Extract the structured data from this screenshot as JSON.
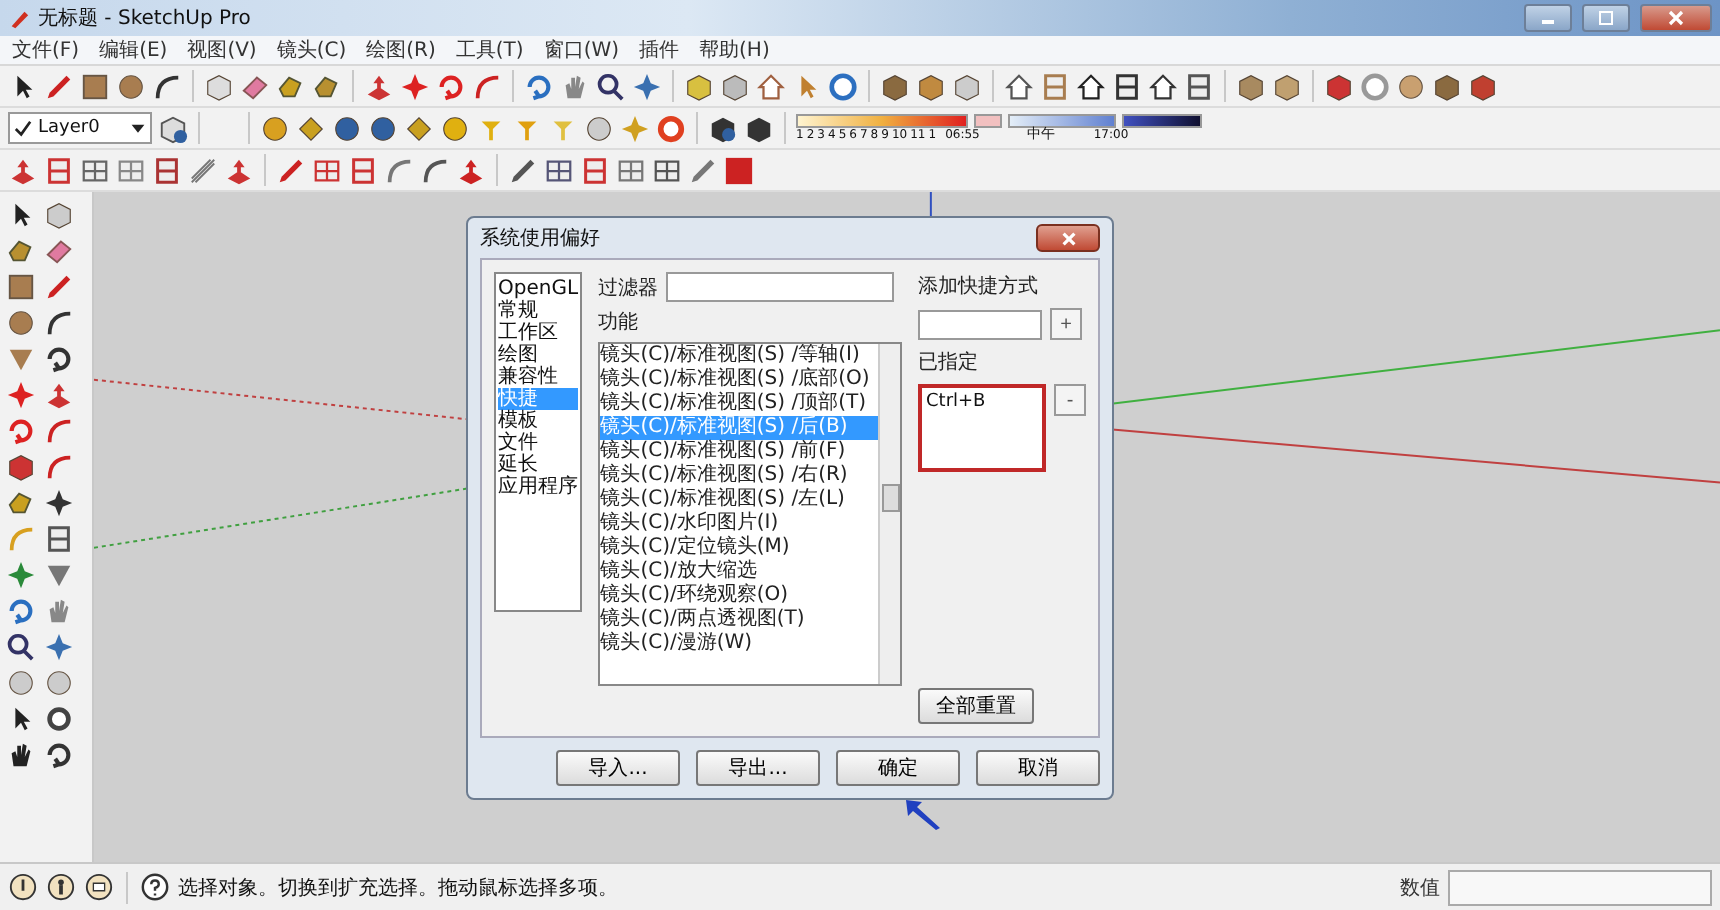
{
  "window": {
    "title": "无标题 - SketchUp Pro"
  },
  "menu": [
    "文件(F)",
    "编辑(E)",
    "视图(V)",
    "镜头(C)",
    "绘图(R)",
    "工具(T)",
    "窗口(W)",
    "插件",
    "帮助(H)"
  ],
  "layer": {
    "name": "Layer0"
  },
  "shadow_settings": {
    "months": [
      "1",
      "2",
      "3",
      "4",
      "5",
      "6",
      "7",
      "8",
      "9",
      "10",
      "11",
      "1"
    ],
    "times": [
      "06:55",
      "中午",
      "17:00"
    ]
  },
  "dialog": {
    "title": "系统使用偏好",
    "categories": [
      {
        "label": "OpenGL",
        "selected": false
      },
      {
        "label": "常规",
        "selected": false
      },
      {
        "label": "工作区",
        "selected": false
      },
      {
        "label": "绘图",
        "selected": false
      },
      {
        "label": "兼容性",
        "selected": false
      },
      {
        "label": "快捷",
        "selected": true
      },
      {
        "label": "模板",
        "selected": false
      },
      {
        "label": "文件",
        "selected": false
      },
      {
        "label": "延长",
        "selected": false
      },
      {
        "label": "应用程序",
        "selected": false
      }
    ],
    "filter_label": "过滤器",
    "function_label": "功能",
    "functions": [
      {
        "label": "镜头(C)/标准视图(S) /等轴(I)",
        "selected": false
      },
      {
        "label": "镜头(C)/标准视图(S) /底部(O)",
        "selected": false
      },
      {
        "label": "镜头(C)/标准视图(S) /顶部(T)",
        "selected": false
      },
      {
        "label": "镜头(C)/标准视图(S) /后(B)",
        "selected": true
      },
      {
        "label": "镜头(C)/标准视图(S) /前(F)",
        "selected": false
      },
      {
        "label": "镜头(C)/标准视图(S) /右(R)",
        "selected": false
      },
      {
        "label": "镜头(C)/标准视图(S) /左(L)",
        "selected": false
      },
      {
        "label": "镜头(C)/水印图片(I)",
        "selected": false
      },
      {
        "label": "镜头(C)/定位镜头(M)",
        "selected": false
      },
      {
        "label": "镜头(C)/放大缩选",
        "selected": false
      },
      {
        "label": "镜头(C)/环绕观察(O)",
        "selected": false
      },
      {
        "label": "镜头(C)/两点透视图(T)",
        "selected": false
      },
      {
        "label": "镜头(C)/漫游(W)",
        "selected": false
      }
    ],
    "add_shortcut_label": "添加快捷方式",
    "add_button": "+",
    "assigned_label": "已指定",
    "assigned": [
      "Ctrl+B"
    ],
    "remove_button": "-",
    "reset_button": "全部重置",
    "buttons": [
      "导入...",
      "导出...",
      "确定",
      "取消"
    ]
  },
  "status_bar": {
    "hint": "选择对象。切换到扩充选择。拖动鼠标选择多项。",
    "measurement_label": "数值"
  }
}
